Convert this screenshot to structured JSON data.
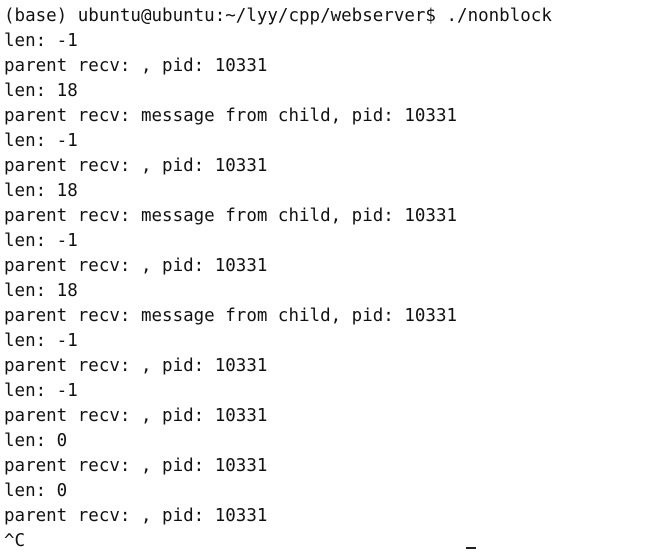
{
  "terminal": {
    "prompt": "(base) ubuntu@ubuntu:~/lyy/cpp/webserver$ ./nonblock",
    "lines": [
      "len: -1",
      "parent recv: , pid: 10331",
      "len: 18",
      "parent recv: message from child, pid: 10331",
      "len: -1",
      "parent recv: , pid: 10331",
      "len: 18",
      "parent recv: message from child, pid: 10331",
      "len: -1",
      "parent recv: , pid: 10331",
      "len: 18",
      "parent recv: message from child, pid: 10331",
      "len: -1",
      "parent recv: , pid: 10331",
      "len: -1",
      "parent recv: , pid: 10331",
      "len: 0",
      "parent recv: , pid: 10331",
      "len: 0",
      "parent recv: , pid: 10331",
      "^C"
    ]
  }
}
